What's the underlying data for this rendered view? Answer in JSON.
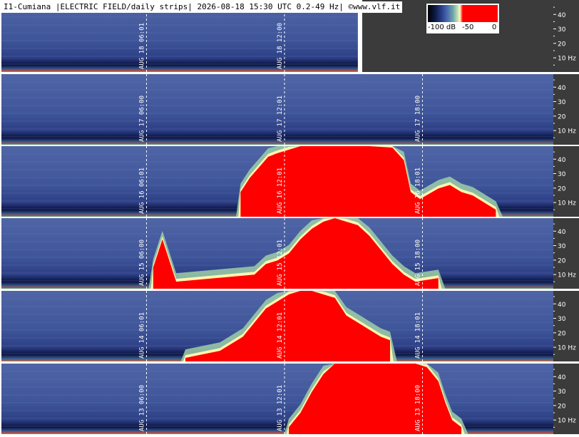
{
  "header": {
    "title": "I1-Cumiana |ELECTRIC FIELD/daily strips| 2026-08-18 15:30 UTC 0.2-49 Hz| ©www.vlf.it"
  },
  "colorbar": {
    "labels": [
      "-100 dB",
      "-50",
      "0"
    ],
    "colors": [
      "#000000",
      "#2a3f8f",
      "#6fa6a8",
      "#fff7c4",
      "#ff0000"
    ]
  },
  "chart_data": {
    "type": "heatmap",
    "y_unit": "Hz",
    "ylim": [
      0.2,
      49
    ],
    "y_ticks": [
      {
        "value": 40,
        "label": "40"
      },
      {
        "value": 30,
        "label": "30"
      },
      {
        "value": 20,
        "label": "20"
      },
      {
        "value": 10,
        "label": "10 Hz"
      }
    ],
    "strips": [
      {
        "date": "AUG 18",
        "ticks": [
          {
            "time": "06:01",
            "hour": 6
          },
          {
            "time": "12:00",
            "hour": 12
          }
        ],
        "end_hour": 15.5,
        "storm": []
      },
      {
        "date": "AUG 17",
        "ticks": [
          {
            "time": "06:00",
            "hour": 6
          },
          {
            "time": "12:01",
            "hour": 12
          },
          {
            "time": "18:00",
            "hour": 18
          }
        ],
        "end_hour": 24,
        "storm": []
      },
      {
        "date": "AUG 16",
        "ticks": [
          {
            "time": "06:01",
            "hour": 6
          },
          {
            "time": "12:01",
            "hour": 12
          },
          {
            "time": "18:01",
            "hour": 18
          }
        ],
        "end_hour": 24,
        "storm": [
          [
            10.4,
            0.35
          ],
          [
            10.8,
            0.55
          ],
          [
            11.2,
            0.7
          ],
          [
            11.6,
            0.85
          ],
          [
            12.0,
            0.9
          ],
          [
            12.5,
            0.95
          ],
          [
            13.0,
            1.0
          ],
          [
            14.0,
            1.0
          ],
          [
            15.0,
            1.0
          ],
          [
            16.0,
            1.0
          ],
          [
            17.0,
            0.98
          ],
          [
            17.5,
            0.8
          ],
          [
            17.8,
            0.35
          ],
          [
            18.2,
            0.25
          ],
          [
            19.0,
            0.4
          ],
          [
            19.5,
            0.45
          ],
          [
            20.0,
            0.35
          ],
          [
            20.5,
            0.3
          ],
          [
            21.0,
            0.2
          ],
          [
            21.5,
            0.1
          ]
        ]
      },
      {
        "date": "AUG 15",
        "ticks": [
          {
            "time": "06:00",
            "hour": 6
          },
          {
            "time": "12:01",
            "hour": 12
          },
          {
            "time": "18:00",
            "hour": 18
          }
        ],
        "end_hour": 24,
        "storm": [
          [
            6.6,
            0.3
          ],
          [
            7.0,
            0.7
          ],
          [
            7.3,
            0.4
          ],
          [
            7.6,
            0.1
          ],
          [
            11.0,
            0.2
          ],
          [
            11.5,
            0.35
          ],
          [
            12.0,
            0.4
          ],
          [
            12.5,
            0.5
          ],
          [
            13.0,
            0.7
          ],
          [
            13.5,
            0.85
          ],
          [
            14.0,
            0.95
          ],
          [
            14.5,
            1.0
          ],
          [
            15.0,
            0.95
          ],
          [
            15.5,
            0.9
          ],
          [
            16.0,
            0.75
          ],
          [
            16.5,
            0.55
          ],
          [
            17.0,
            0.35
          ],
          [
            17.5,
            0.2
          ],
          [
            18.0,
            0.1
          ],
          [
            19.0,
            0.15
          ]
        ]
      },
      {
        "date": "AUG 14",
        "ticks": [
          {
            "time": "06:01",
            "hour": 6
          },
          {
            "time": "12:01",
            "hour": 12
          },
          {
            "time": "18:01",
            "hour": 18
          }
        ],
        "end_hour": 24,
        "storm": [
          [
            8.0,
            0.05
          ],
          [
            9.5,
            0.15
          ],
          [
            10.5,
            0.35
          ],
          [
            11.0,
            0.55
          ],
          [
            11.5,
            0.75
          ],
          [
            12.0,
            0.85
          ],
          [
            12.5,
            0.95
          ],
          [
            13.0,
            1.0
          ],
          [
            13.5,
            1.0
          ],
          [
            14.0,
            0.95
          ],
          [
            14.5,
            0.9
          ],
          [
            15.0,
            0.65
          ],
          [
            15.5,
            0.55
          ],
          [
            16.0,
            0.45
          ],
          [
            16.5,
            0.35
          ],
          [
            16.9,
            0.3
          ]
        ]
      },
      {
        "date": "AUG 13",
        "ticks": [
          {
            "time": "06:00",
            "hour": 6
          },
          {
            "time": "12:01",
            "hour": 12
          },
          {
            "time": "18:00",
            "hour": 18
          }
        ],
        "end_hour": 24,
        "storm": [
          [
            12.5,
            0.1
          ],
          [
            13.0,
            0.3
          ],
          [
            13.5,
            0.6
          ],
          [
            14.0,
            0.85
          ],
          [
            14.5,
            1.0
          ],
          [
            15.0,
            1.0
          ],
          [
            16.0,
            1.0
          ],
          [
            17.0,
            1.0
          ],
          [
            18.0,
            1.0
          ],
          [
            18.5,
            0.95
          ],
          [
            19.0,
            0.75
          ],
          [
            19.3,
            0.45
          ],
          [
            19.6,
            0.2
          ],
          [
            20.0,
            0.1
          ]
        ]
      }
    ]
  }
}
